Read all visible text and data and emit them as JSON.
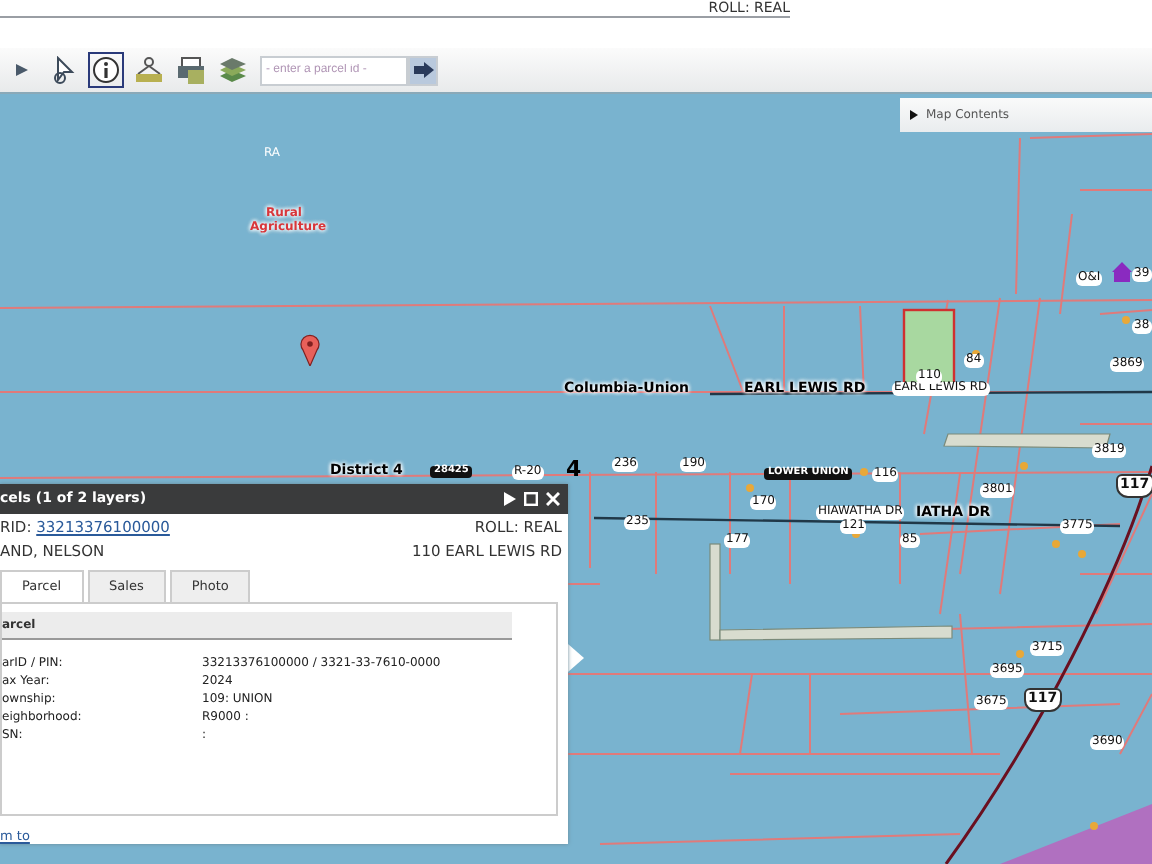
{
  "header": {
    "roll": "ROLL: REAL"
  },
  "toolbar": {
    "tools": [
      {
        "kind": "pan",
        "selected": false
      },
      {
        "kind": "select",
        "selected": false
      },
      {
        "kind": "identify",
        "selected": true
      },
      {
        "kind": "network",
        "selected": false
      },
      {
        "kind": "print",
        "selected": false
      },
      {
        "kind": "layers",
        "selected": false
      }
    ],
    "parcel_search": {
      "placeholder": "- enter a parcel id -"
    }
  },
  "map_contents": {
    "label": "Map Contents",
    "expanded": false
  },
  "map_labels": [
    {
      "text": "RA",
      "kind": "code"
    },
    {
      "text": "Rural Agriculture",
      "kind": "zone"
    },
    {
      "text": "Columbia-Union",
      "kind": "road"
    },
    {
      "text": "EARL LEWIS RD",
      "kind": "road"
    },
    {
      "text": "EARL LEWIS RD",
      "kind": "address"
    },
    {
      "text": "110",
      "kind": "address"
    },
    {
      "text": "84",
      "kind": "address"
    },
    {
      "text": "O&I",
      "kind": "address"
    },
    {
      "text": "39",
      "kind": "address"
    },
    {
      "text": "38",
      "kind": "address"
    },
    {
      "text": "3869",
      "kind": "address"
    },
    {
      "text": "3819",
      "kind": "address"
    },
    {
      "text": "District 4",
      "kind": "road"
    },
    {
      "text": "28425",
      "kind": "tag"
    },
    {
      "text": "R-20",
      "kind": "address"
    },
    {
      "text": "4",
      "kind": "number"
    },
    {
      "text": "236",
      "kind": "address"
    },
    {
      "text": "190",
      "kind": "address"
    },
    {
      "text": "LOWER UNION",
      "kind": "tag"
    },
    {
      "text": "116",
      "kind": "address"
    },
    {
      "text": "170",
      "kind": "address"
    },
    {
      "text": "3801",
      "kind": "address"
    },
    {
      "text": "235",
      "kind": "address"
    },
    {
      "text": "HIAWATHA DR",
      "kind": "address"
    },
    {
      "text": "IATHA DR",
      "kind": "road"
    },
    {
      "text": "121",
      "kind": "address"
    },
    {
      "text": "85",
      "kind": "address"
    },
    {
      "text": "177",
      "kind": "address"
    },
    {
      "text": "3775",
      "kind": "address"
    },
    {
      "text": "117",
      "kind": "shield"
    },
    {
      "text": "3715",
      "kind": "address"
    },
    {
      "text": "3695",
      "kind": "address"
    },
    {
      "text": "3675",
      "kind": "address"
    },
    {
      "text": "117",
      "kind": "shield"
    },
    {
      "text": "3690",
      "kind": "address"
    }
  ],
  "popup": {
    "title": "cels (1 of 2 layers)",
    "id_label": "RID:",
    "id_link": "33213376100000",
    "roll": "ROLL: REAL",
    "owner": "AND, NELSON",
    "address": "110 EARL LEWIS RD",
    "tabs": [
      {
        "label": "Parcel",
        "selected": true
      },
      {
        "label": "Sales",
        "selected": false
      },
      {
        "label": "Photo",
        "selected": false
      }
    ],
    "section": "arcel",
    "fields": [
      {
        "label": "arID / PIN:",
        "value": "33213376100000 / 3321-33-7610-0000"
      },
      {
        "label": "ax Year:",
        "value": "2024"
      },
      {
        "label": "ownship:",
        "value": "109: UNION"
      },
      {
        "label": "eighborhood:",
        "value": "R9000 :"
      },
      {
        "label": "SN:",
        "value": ":"
      }
    ],
    "footer_link": "m to"
  }
}
